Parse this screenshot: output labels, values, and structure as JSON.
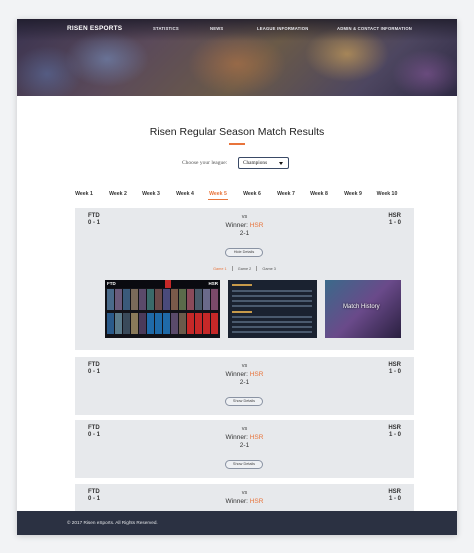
{
  "nav": {
    "brand": "RISEN ESPORTS",
    "links": [
      "STATISTICS",
      "NEWS",
      "LEAGUE INFORMATION",
      "ADMIN & CONTACT INFORMATION"
    ]
  },
  "page": {
    "title": "Risen Regular Season Match Results",
    "league_label": "Choose your league:",
    "league_value": "Champions"
  },
  "weeks": [
    "Week 1",
    "Week 2",
    "Week 3",
    "Week 4",
    "Week 5",
    "Week 6",
    "Week 7",
    "Week 8",
    "Week 9",
    "Week 10"
  ],
  "active_week": "Week 5",
  "matches": [
    {
      "left_team": "FTD",
      "left_score": "0 - 1",
      "vs": "vs",
      "winner_label": "Winner:",
      "winner_team": "HSR",
      "series": "2-1",
      "right_team": "HSR",
      "right_score": "1 - 0",
      "button": "Hide Details"
    },
    {
      "left_team": "FTD",
      "left_score": "0 - 1",
      "vs": "vs",
      "winner_label": "Winner:",
      "winner_team": "HSR",
      "series": "2-1",
      "right_team": "HSR",
      "right_score": "1 - 0",
      "button": "Show Details"
    },
    {
      "left_team": "FTD",
      "left_score": "0 - 1",
      "vs": "vs",
      "winner_label": "Winner:",
      "winner_team": "HSR",
      "series": "2-1",
      "right_team": "HSR",
      "right_score": "1 - 0",
      "button": "Show Details"
    },
    {
      "left_team": "FTD",
      "left_score": "0 - 1",
      "vs": "vs",
      "winner_label": "Winner:",
      "winner_team": "HSR",
      "right_team": "HSR",
      "right_score": "1 - 0"
    }
  ],
  "details": {
    "games": [
      "Game 1",
      "Game 2",
      "Game 3"
    ],
    "active_game": "Game 1",
    "draft_left": "FTD",
    "draft_right": "HSR",
    "match_history_label": "Match History"
  },
  "footer": {
    "text": "© 2017 Risen eSports. All Rights Reserved."
  },
  "colors": {
    "accent": "#e8743b",
    "footer_bg": "#2b3142",
    "card_bg": "#e7e9ec"
  }
}
